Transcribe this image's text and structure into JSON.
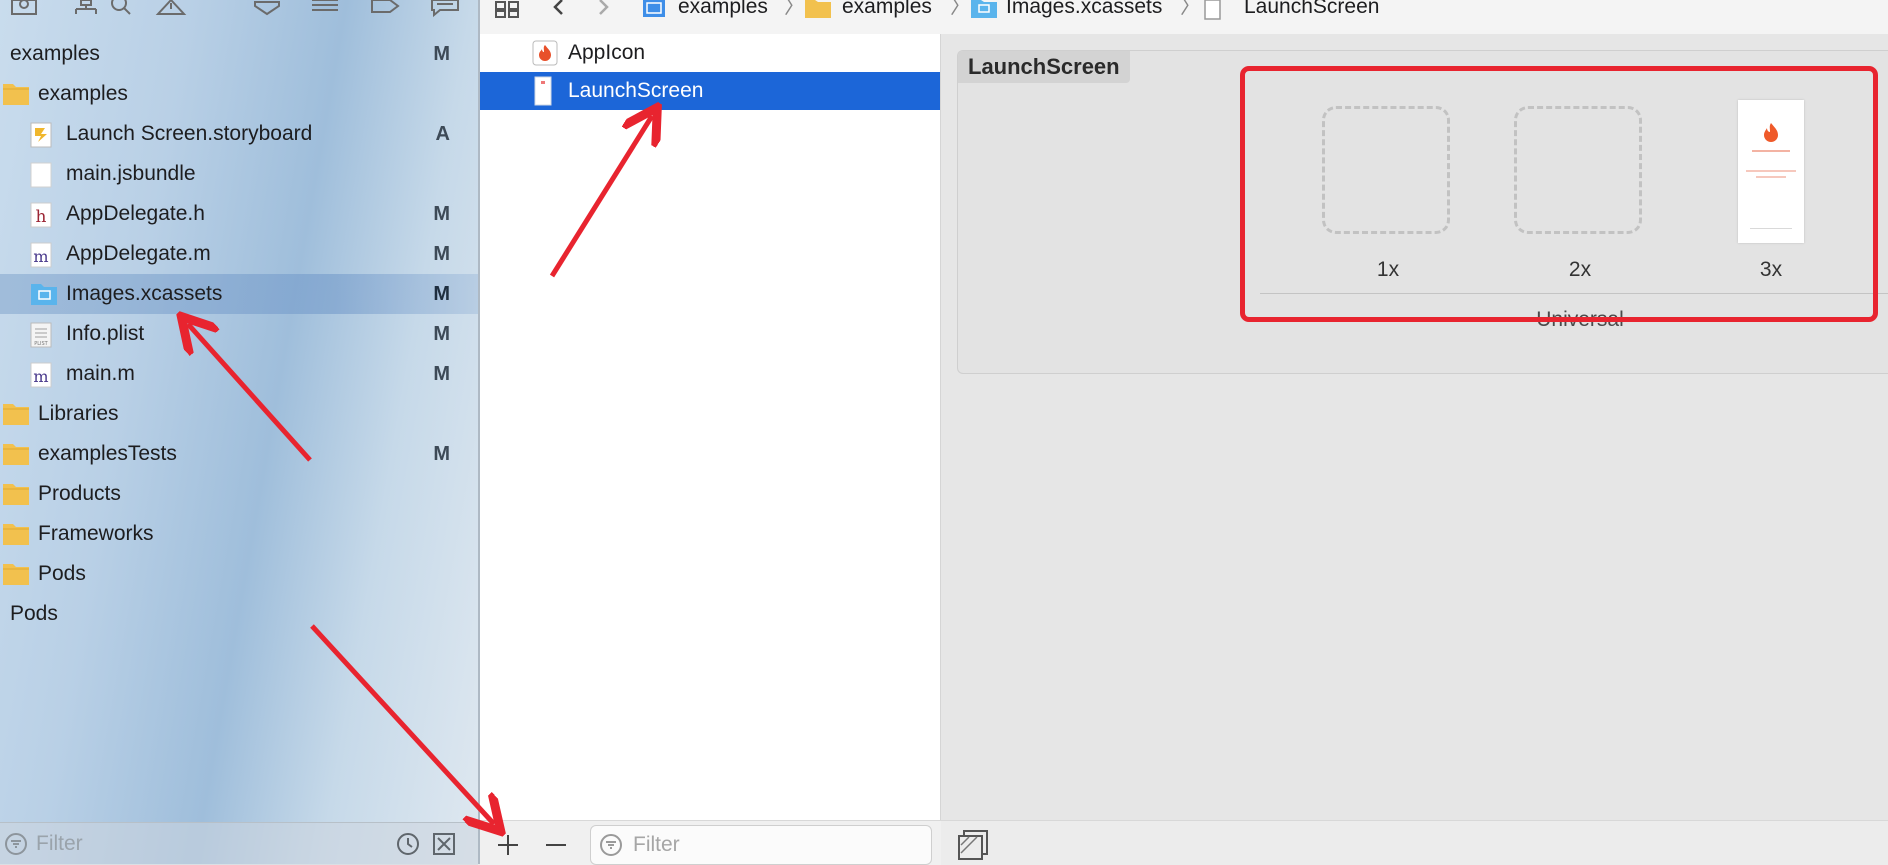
{
  "navigator": {
    "toolbar_icons": [
      "project-navigator-icon",
      "source-control-icon",
      "find-icon",
      "issue-icon",
      "test-icon",
      "debug-icon",
      "breakpoint-icon",
      "report-icon"
    ],
    "rows": [
      {
        "label": "examples",
        "status": "M",
        "icon": "none",
        "indent": 0
      },
      {
        "label": "examples",
        "status": "",
        "icon": "folder-icon",
        "indent": 1
      },
      {
        "label": "Launch Screen.storyboard",
        "status": "A",
        "icon": "storyboard-file-icon",
        "indent": 2
      },
      {
        "label": "main.jsbundle",
        "status": "",
        "icon": "blank-file-icon",
        "indent": 2
      },
      {
        "label": "AppDelegate.h",
        "status": "M",
        "icon": "header-file-icon",
        "indent": 2,
        "glyph": "h"
      },
      {
        "label": "AppDelegate.m",
        "status": "M",
        "icon": "objc-file-icon",
        "indent": 2,
        "glyph": "m"
      },
      {
        "label": "Images.xcassets",
        "status": "M",
        "icon": "asset-catalog-icon",
        "indent": 2,
        "selected": true
      },
      {
        "label": "Info.plist",
        "status": "M",
        "icon": "plist-file-icon",
        "indent": 2
      },
      {
        "label": "main.m",
        "status": "M",
        "icon": "objc-file-icon",
        "indent": 2,
        "glyph": "m"
      },
      {
        "label": "Libraries",
        "status": "",
        "icon": "folder-icon",
        "indent": 1
      },
      {
        "label": "examplesTests",
        "status": "M",
        "icon": "folder-icon",
        "indent": 1
      },
      {
        "label": "Products",
        "status": "",
        "icon": "folder-icon",
        "indent": 1
      },
      {
        "label": "Frameworks",
        "status": "",
        "icon": "folder-icon",
        "indent": 1
      },
      {
        "label": "Pods",
        "status": "",
        "icon": "folder-icon",
        "indent": 1
      },
      {
        "label": "Pods",
        "status": "",
        "icon": "none",
        "indent": 0
      }
    ],
    "filter_placeholder": "Filter"
  },
  "jump_bar": {
    "crumbs": [
      "examples",
      "examples",
      "Images.xcassets",
      "LaunchScreen"
    ]
  },
  "asset_list": {
    "items": [
      {
        "label": "AppIcon",
        "icon": "app-icon-set-icon"
      },
      {
        "label": "LaunchScreen",
        "icon": "image-set-icon",
        "selected": true
      }
    ],
    "filter_placeholder": "Filter"
  },
  "asset_editor": {
    "set_title": "LaunchScreen",
    "slots": [
      {
        "label": "1x",
        "filled": false
      },
      {
        "label": "2x",
        "filled": false
      },
      {
        "label": "3x",
        "filled": true
      }
    ],
    "device_label": "Universal"
  },
  "colors": {
    "selection_blue": "#1c66d8",
    "annotation_red": "#e8242f",
    "folder_yellow": "#f2c14e",
    "asset_folder_blue": "#5ab4ec"
  }
}
